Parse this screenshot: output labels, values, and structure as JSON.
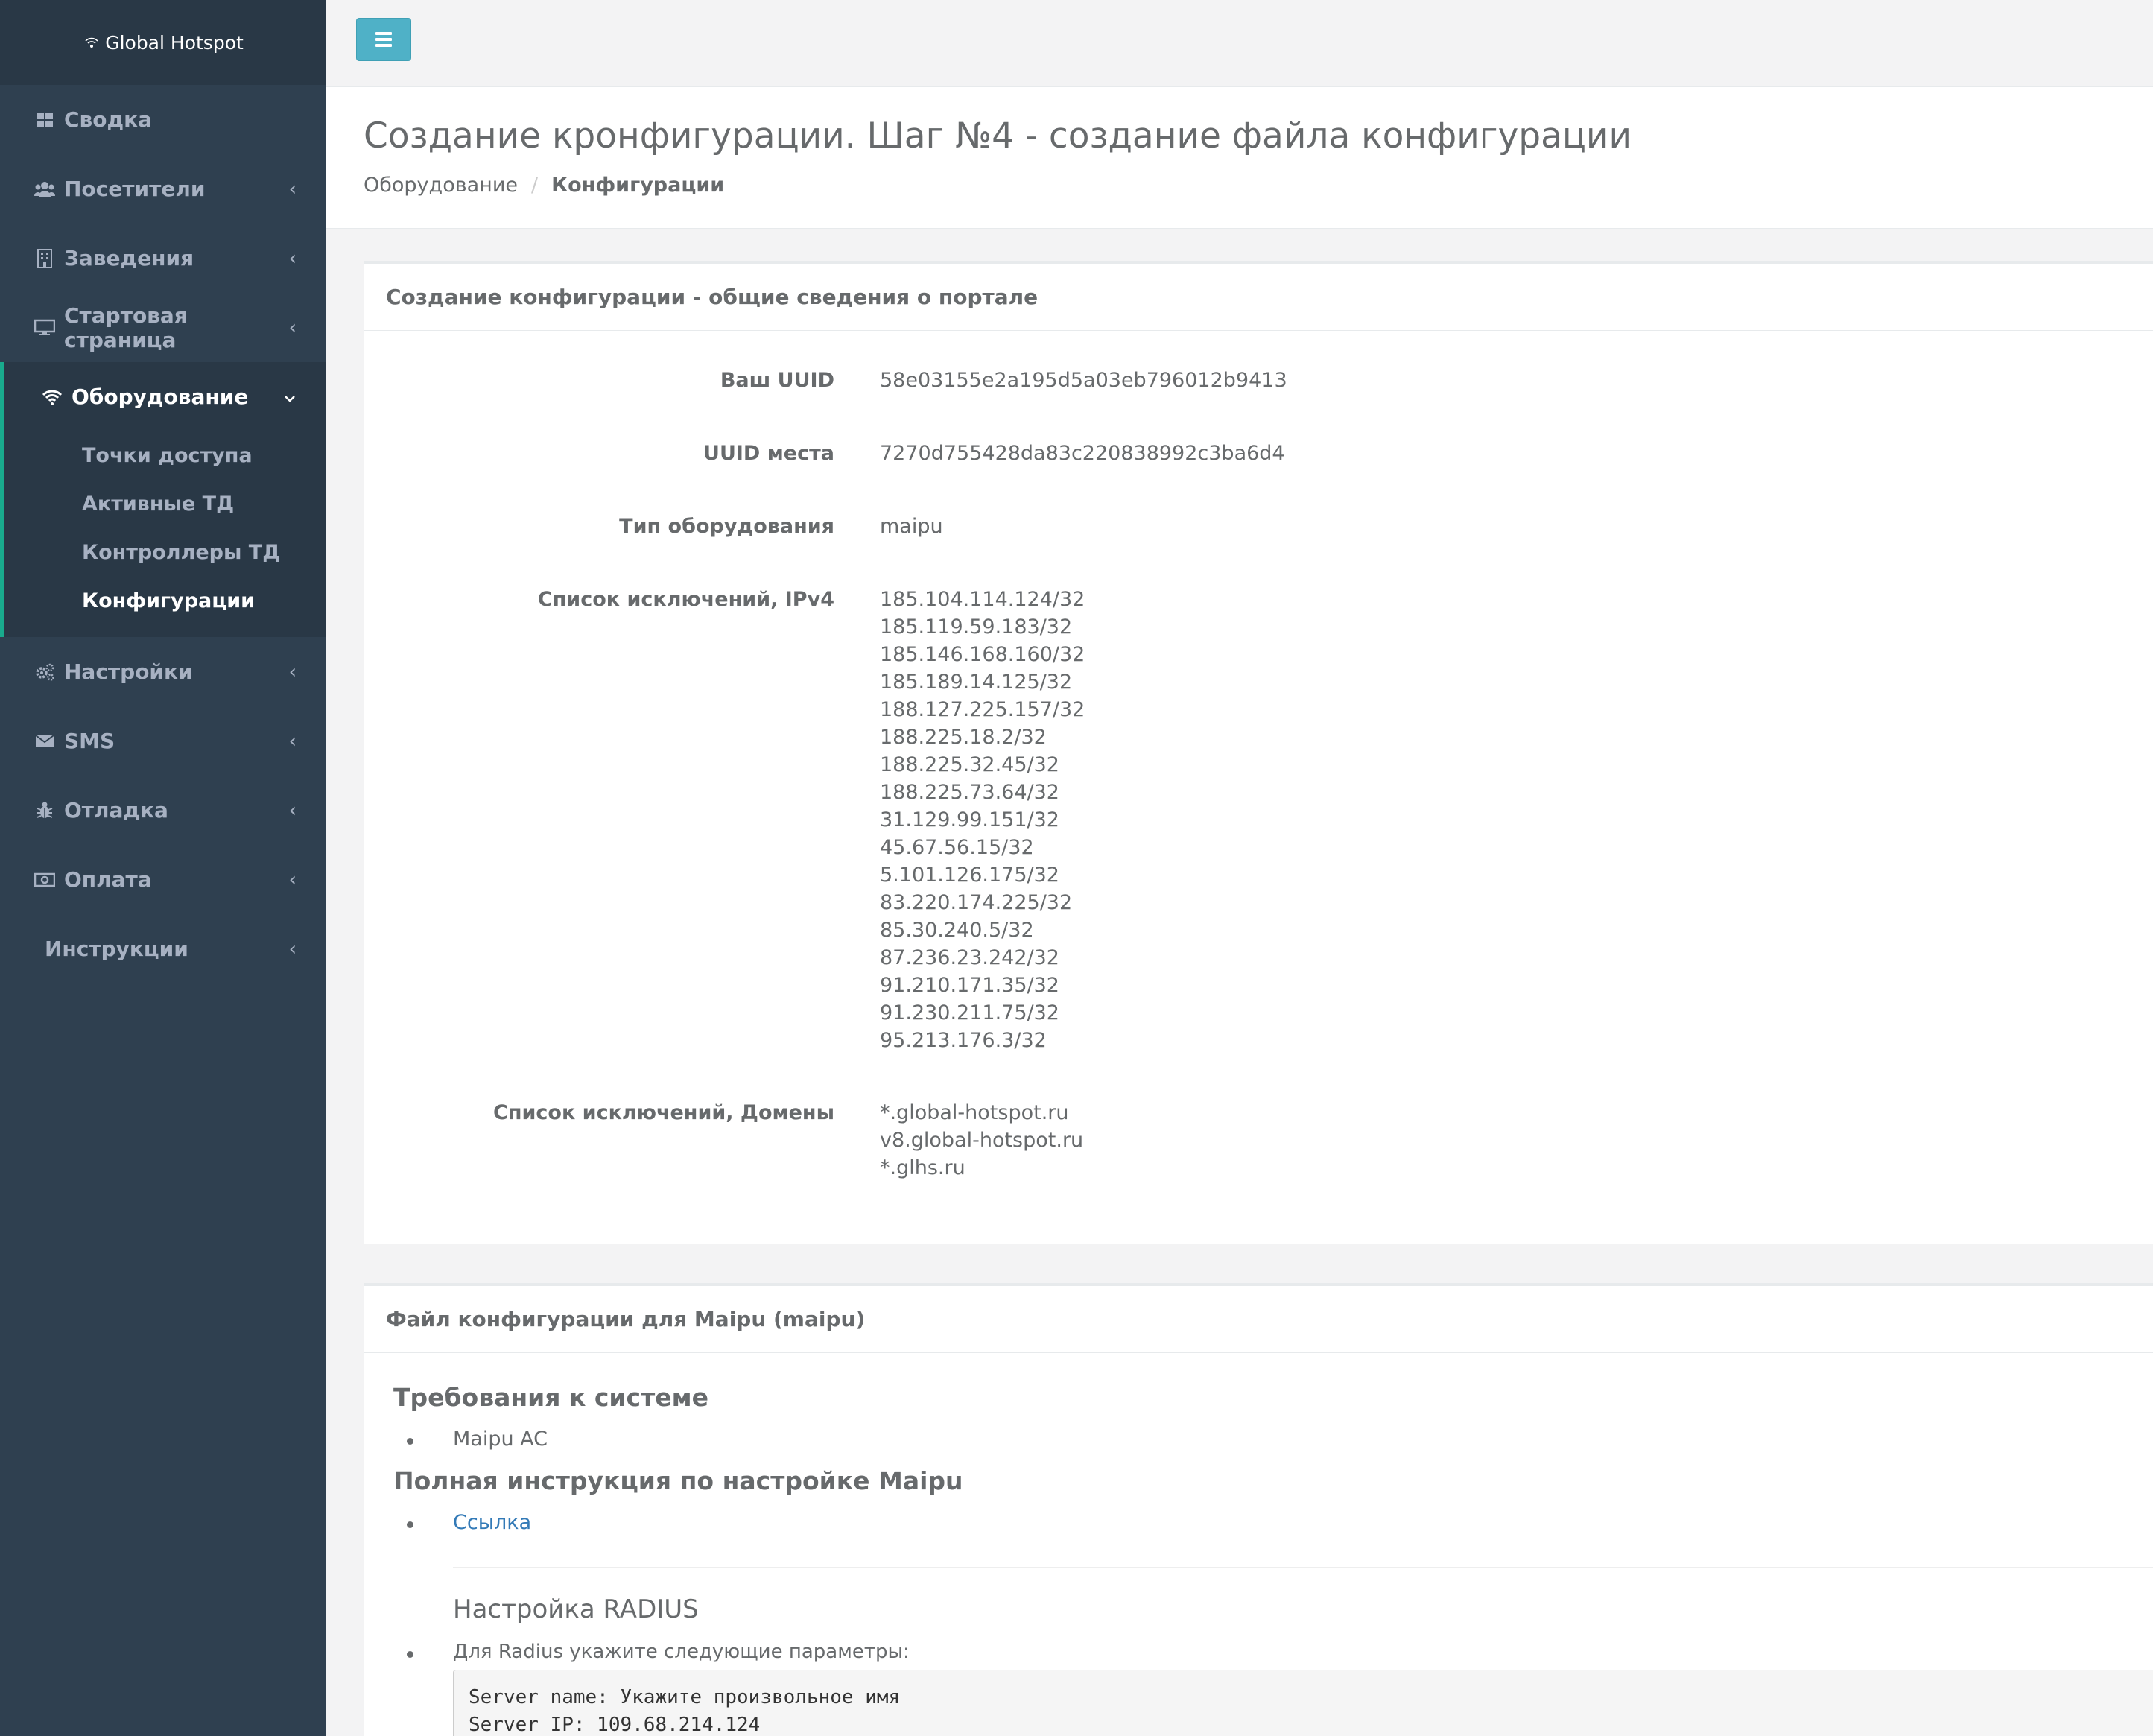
{
  "app": {
    "brand": "Global Hotspot"
  },
  "sidebar": {
    "items": [
      {
        "label": "Сводка",
        "icon": "dashboard-icon",
        "has_children": false
      },
      {
        "label": "Посетители",
        "icon": "users-icon",
        "has_children": true
      },
      {
        "label": "Заведения",
        "icon": "building-icon",
        "has_children": true
      },
      {
        "label": "Стартовая страница",
        "icon": "desktop-icon",
        "has_children": true
      },
      {
        "label": "Оборудование",
        "icon": "wifi-icon",
        "has_children": true,
        "expanded": true,
        "children": [
          {
            "label": "Точки доступа"
          },
          {
            "label": "Активные ТД"
          },
          {
            "label": "Контроллеры ТД"
          },
          {
            "label": "Конфигурации",
            "active": true
          }
        ]
      },
      {
        "label": "Настройки",
        "icon": "cogs-icon",
        "has_children": true
      },
      {
        "label": "SMS",
        "icon": "envelope-icon",
        "has_children": true
      },
      {
        "label": "Отладка",
        "icon": "bug-icon",
        "has_children": true
      },
      {
        "label": "Оплата",
        "icon": "money-icon",
        "has_children": true
      },
      {
        "label": "Инструкции",
        "icon": "",
        "has_children": true
      }
    ],
    "chevron_left": "‹",
    "chevron_down": "⌄"
  },
  "header": {
    "title": "Создание кронфигурации. Шаг №4 - создание файла конфигурации",
    "breadcrumb": [
      "Оборудование",
      "Конфигурации"
    ],
    "breadcrumb_sep": "/"
  },
  "panel1": {
    "title": "Создание конфигурации - общие сведения о портале",
    "rows": [
      {
        "label": "Ваш UUID",
        "values": [
          "58e03155e2a195d5a03eb796012b9413"
        ]
      },
      {
        "label": "UUID места",
        "values": [
          "7270d755428da83c220838992c3ba6d4"
        ]
      },
      {
        "label": "Тип оборудования",
        "values": [
          "maipu"
        ]
      },
      {
        "label": "Список исключений, IPv4",
        "values": [
          "185.104.114.124/32",
          "185.119.59.183/32",
          "185.146.168.160/32",
          "185.189.14.125/32",
          "188.127.225.157/32",
          "188.225.18.2/32",
          "188.225.32.45/32",
          "188.225.73.64/32",
          "31.129.99.151/32",
          "45.67.56.15/32",
          "5.101.126.175/32",
          "83.220.174.225/32",
          "85.30.240.5/32",
          "87.236.23.242/32",
          "91.210.171.35/32",
          "91.230.211.75/32",
          "95.213.176.3/32"
        ]
      },
      {
        "label": "Список исключений, Домены",
        "values": [
          "*.global-hotspot.ru",
          "v8.global-hotspot.ru",
          "*.glhs.ru"
        ]
      }
    ]
  },
  "panel2": {
    "title": "Файл конфигурации для Maipu (maipu)",
    "requirements_heading": "Требования к системе",
    "requirements": [
      "Maipu AC"
    ],
    "instruction_heading": "Полная инструкция по настройке Maipu",
    "instruction_link": "Ссылка",
    "radius_heading": "Настройка RADIUS",
    "radius_intro": "Для Radius укажите следующие параметры:",
    "code_lines": [
      "Server name: Укажите произвольное имя",
      "Server IP: 109.68.214.124"
    ]
  },
  "colors": {
    "sidebar_bg": "#2f4050",
    "sidebar_active_border": "#19aa8d",
    "menu_button": "#4fb1c7",
    "link": "#337ab7"
  }
}
